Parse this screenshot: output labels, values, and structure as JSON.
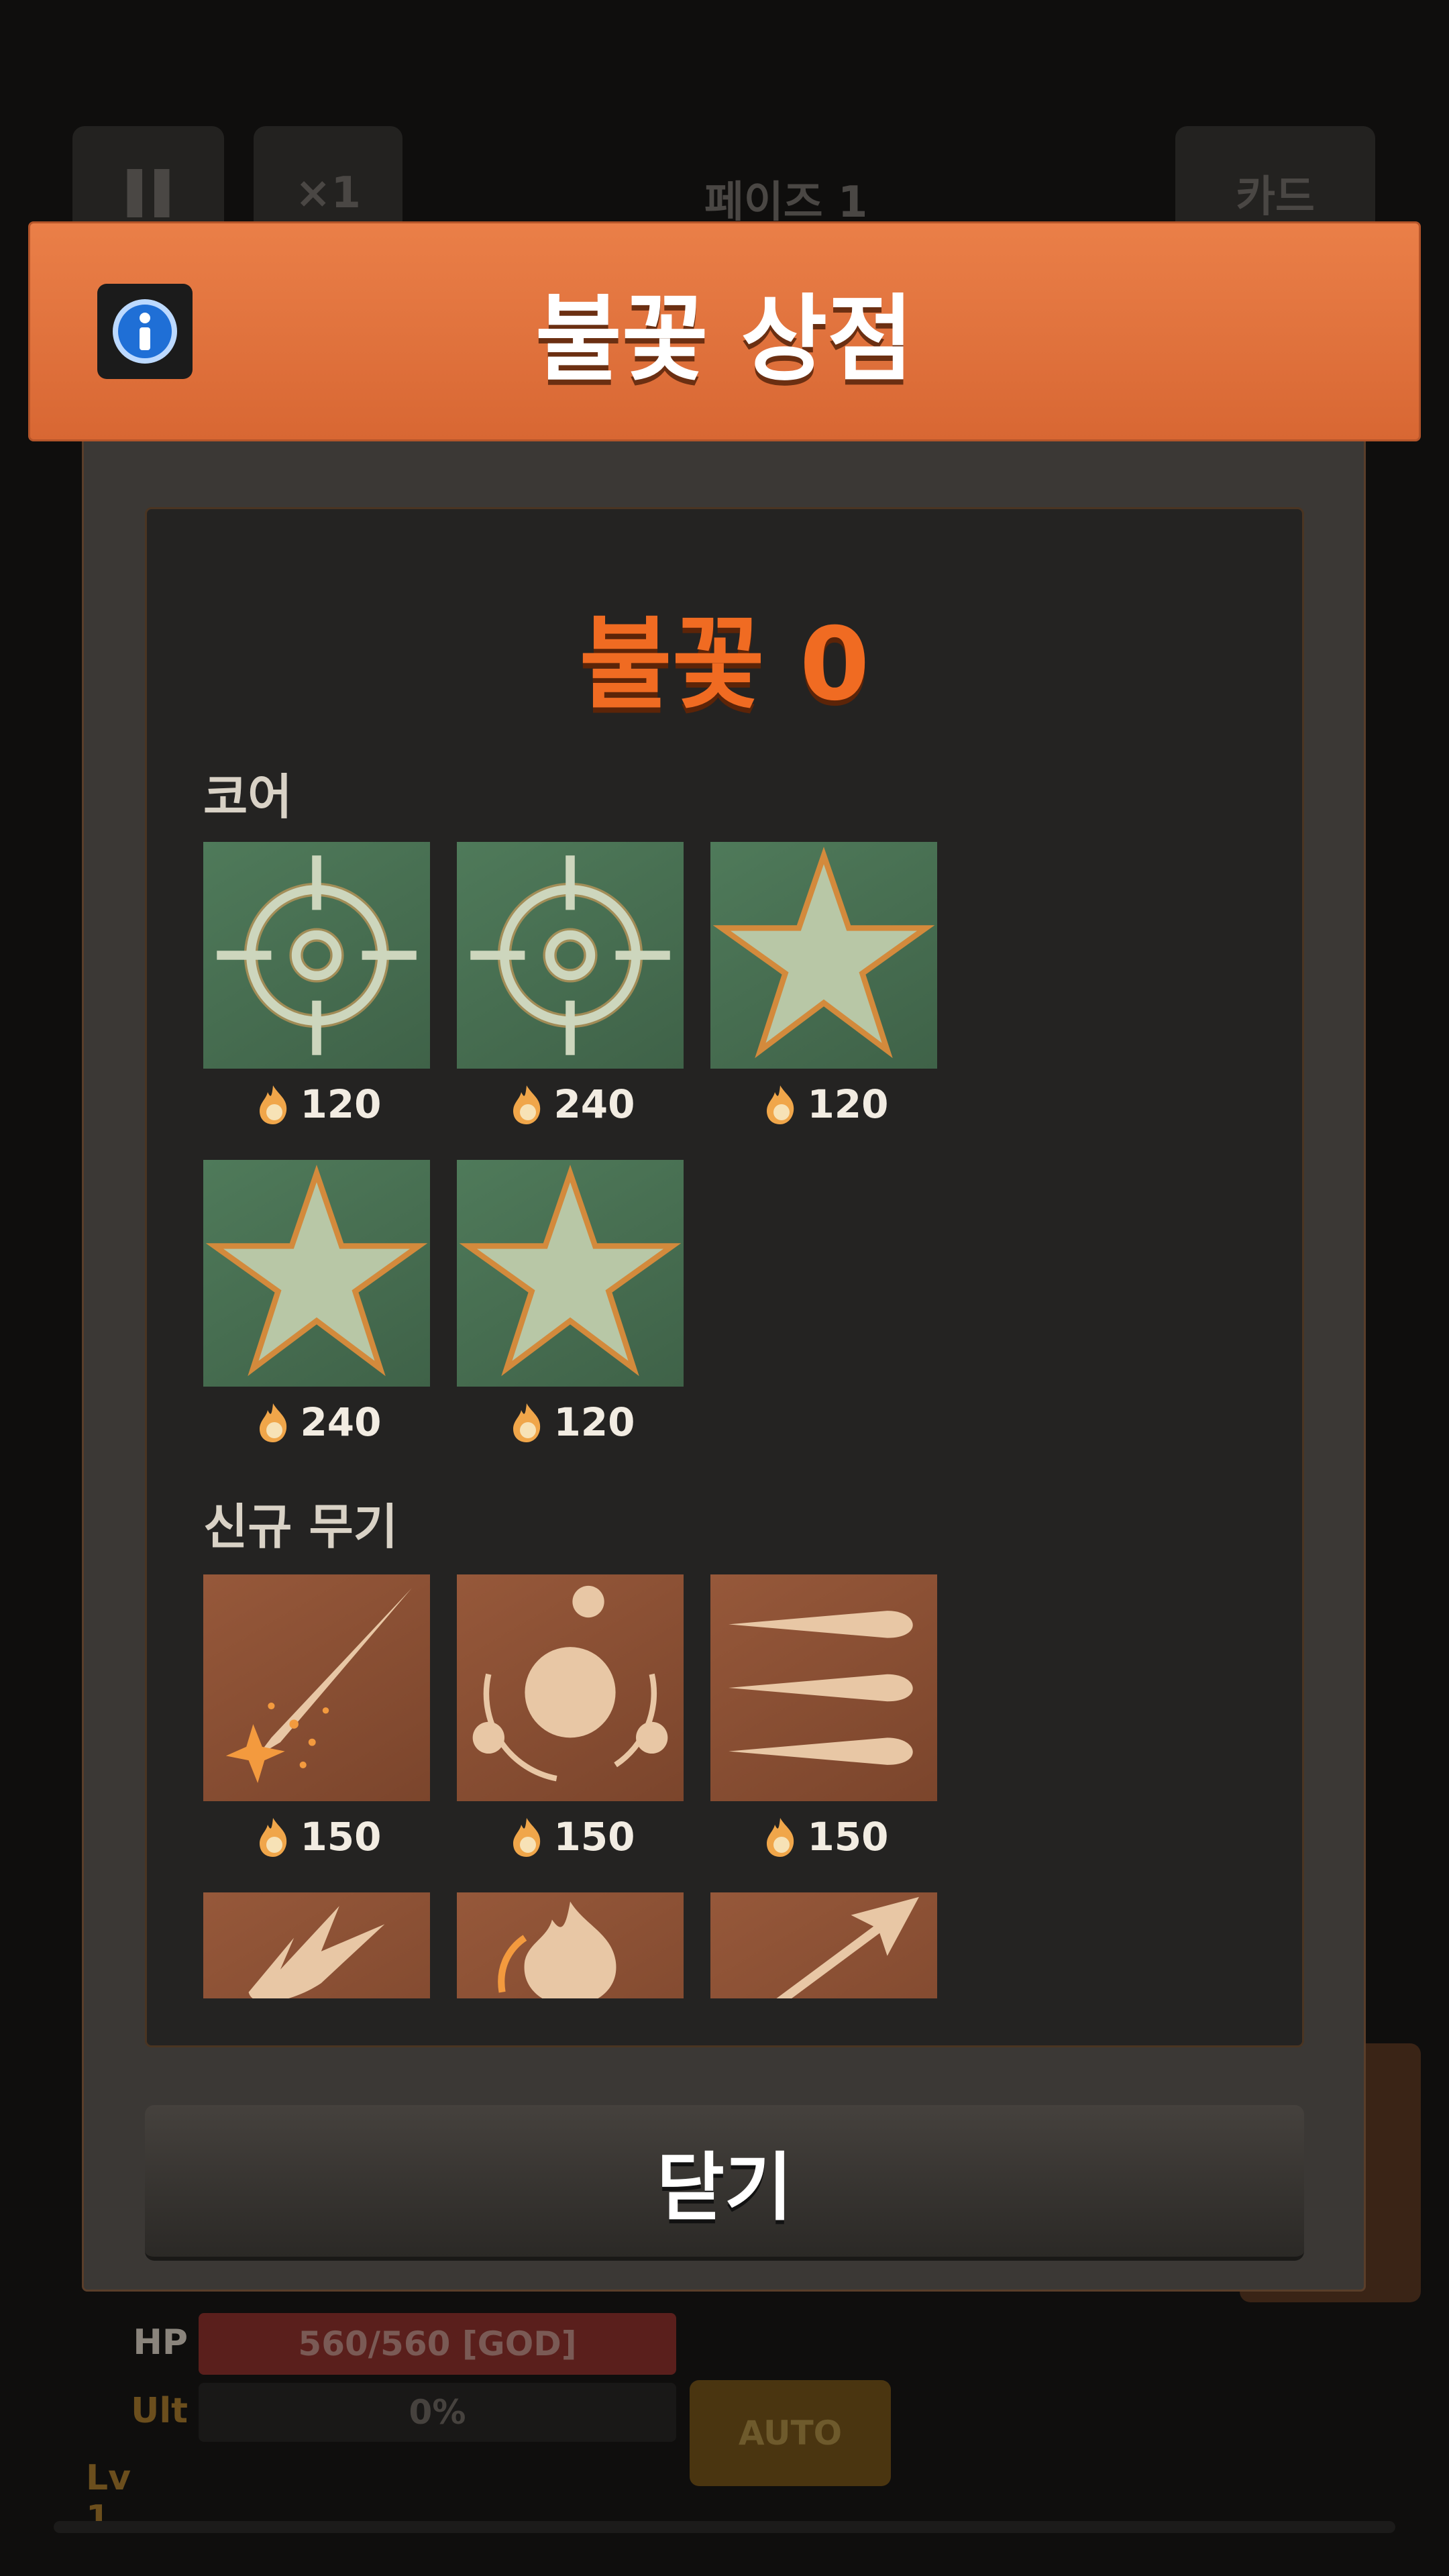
{
  "background": {
    "pause_icon": "pause-icon",
    "speed_label": "×1",
    "phase_label": "페이즈 1",
    "card_label": "카드",
    "hp_label": "HP",
    "hp_value": "560/560 [GOD]",
    "ult_label": "Ult",
    "ult_value": "0%",
    "level_label": "Lv 1",
    "auto_label": "AUTO"
  },
  "modal": {
    "title": "불꽃 상점",
    "info_icon": "info-icon",
    "currency_label": "불꽃",
    "currency_value": "0",
    "close_label": "닫기",
    "sections": [
      {
        "title": "코어",
        "items": [
          {
            "icon": "crosshair-icon",
            "price": "120"
          },
          {
            "icon": "crosshair-icon",
            "price": "240"
          },
          {
            "icon": "star-icon",
            "price": "120"
          },
          {
            "icon": "star-icon",
            "price": "240"
          },
          {
            "icon": "star-icon",
            "price": "120"
          }
        ]
      },
      {
        "title": "신규 무기",
        "items": [
          {
            "icon": "meteor-streak-icon",
            "price": "150"
          },
          {
            "icon": "orbit-orbs-icon",
            "price": "150"
          },
          {
            "icon": "triple-projectile-icon",
            "price": "150"
          },
          {
            "icon": "slash-burst-icon"
          },
          {
            "icon": "flame-icon"
          },
          {
            "icon": "arrow-icon"
          }
        ]
      }
    ]
  },
  "colors": {
    "header": "#e07438",
    "currency": "#f06b22",
    "core_tile": "#48705a",
    "weapon_tile": "#8a4f34"
  }
}
